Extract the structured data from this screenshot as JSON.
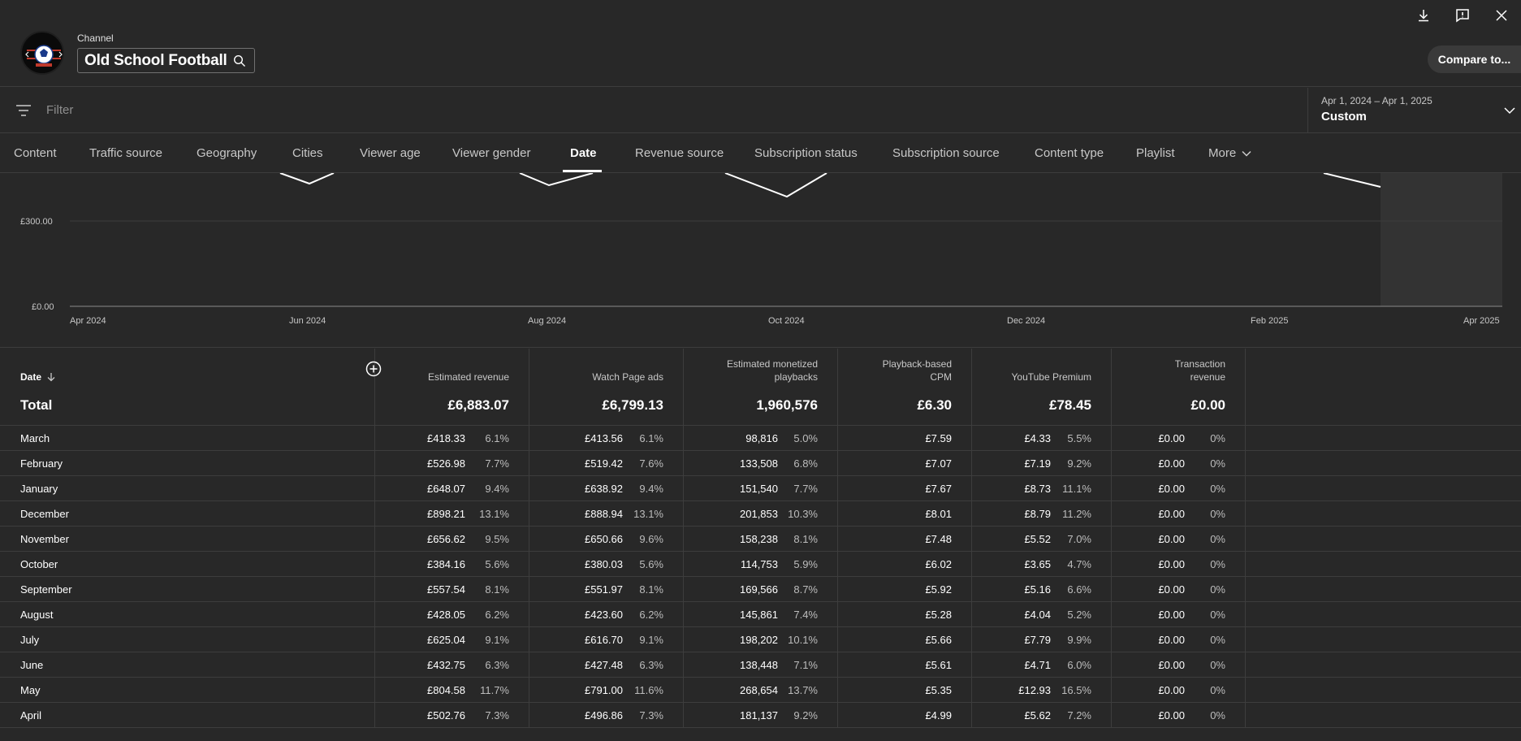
{
  "channel": {
    "label": "Channel",
    "name": "Old School Football"
  },
  "header": {
    "compare_label": "Compare to..."
  },
  "filter": {
    "placeholder": "Filter"
  },
  "date_range": {
    "range": "Apr 1, 2024 – Apr 1, 2025",
    "mode": "Custom"
  },
  "tabs": [
    {
      "label": "Content"
    },
    {
      "label": "Traffic source"
    },
    {
      "label": "Geography"
    },
    {
      "label": "Cities"
    },
    {
      "label": "Viewer age"
    },
    {
      "label": "Viewer gender"
    },
    {
      "label": "Date"
    },
    {
      "label": "Revenue source"
    },
    {
      "label": "Subscription status"
    },
    {
      "label": "Subscription source"
    },
    {
      "label": "Content type"
    },
    {
      "label": "Playlist"
    },
    {
      "label": "More"
    }
  ],
  "chart_data": {
    "type": "line",
    "y_ticks": [
      "£300.00",
      "£0.00"
    ],
    "x_ticks": [
      "Apr 2024",
      "Jun 2024",
      "Aug 2024",
      "Oct 2024",
      "Dec 2024",
      "Feb 2025",
      "Apr 2025"
    ]
  },
  "table": {
    "headers": {
      "date": "Date",
      "estimated_revenue": "Estimated revenue",
      "watch_page_ads": "Watch Page ads",
      "monetized_playbacks_1": "Estimated monetized",
      "monetized_playbacks_2": "playbacks",
      "cpm_1": "Playback-based",
      "cpm_2": "CPM",
      "premium": "YouTube Premium",
      "transaction_1": "Transaction",
      "transaction_2": "revenue"
    },
    "total": {
      "label": "Total",
      "revenue": "£6,883.07",
      "watch": "£6,799.13",
      "playbacks": "1,960,576",
      "cpm": "£6.30",
      "premium": "£78.45",
      "transaction": "£0.00"
    },
    "rows": [
      {
        "date": "March",
        "revenue": "£418.33",
        "revenue_pct": "6.1%",
        "watch": "£413.56",
        "watch_pct": "6.1%",
        "playbacks": "98,816",
        "playbacks_pct": "5.0%",
        "cpm": "£7.59",
        "premium": "£4.33",
        "premium_pct": "5.5%",
        "transaction": "£0.00",
        "transaction_pct": "0%"
      },
      {
        "date": "February",
        "revenue": "£526.98",
        "revenue_pct": "7.7%",
        "watch": "£519.42",
        "watch_pct": "7.6%",
        "playbacks": "133,508",
        "playbacks_pct": "6.8%",
        "cpm": "£7.07",
        "premium": "£7.19",
        "premium_pct": "9.2%",
        "transaction": "£0.00",
        "transaction_pct": "0%"
      },
      {
        "date": "January",
        "revenue": "£648.07",
        "revenue_pct": "9.4%",
        "watch": "£638.92",
        "watch_pct": "9.4%",
        "playbacks": "151,540",
        "playbacks_pct": "7.7%",
        "cpm": "£7.67",
        "premium": "£8.73",
        "premium_pct": "11.1%",
        "transaction": "£0.00",
        "transaction_pct": "0%"
      },
      {
        "date": "December",
        "revenue": "£898.21",
        "revenue_pct": "13.1%",
        "watch": "£888.94",
        "watch_pct": "13.1%",
        "playbacks": "201,853",
        "playbacks_pct": "10.3%",
        "cpm": "£8.01",
        "premium": "£8.79",
        "premium_pct": "11.2%",
        "transaction": "£0.00",
        "transaction_pct": "0%"
      },
      {
        "date": "November",
        "revenue": "£656.62",
        "revenue_pct": "9.5%",
        "watch": "£650.66",
        "watch_pct": "9.6%",
        "playbacks": "158,238",
        "playbacks_pct": "8.1%",
        "cpm": "£7.48",
        "premium": "£5.52",
        "premium_pct": "7.0%",
        "transaction": "£0.00",
        "transaction_pct": "0%"
      },
      {
        "date": "October",
        "revenue": "£384.16",
        "revenue_pct": "5.6%",
        "watch": "£380.03",
        "watch_pct": "5.6%",
        "playbacks": "114,753",
        "playbacks_pct": "5.9%",
        "cpm": "£6.02",
        "premium": "£3.65",
        "premium_pct": "4.7%",
        "transaction": "£0.00",
        "transaction_pct": "0%"
      },
      {
        "date": "September",
        "revenue": "£557.54",
        "revenue_pct": "8.1%",
        "watch": "£551.97",
        "watch_pct": "8.1%",
        "playbacks": "169,566",
        "playbacks_pct": "8.7%",
        "cpm": "£5.92",
        "premium": "£5.16",
        "premium_pct": "6.6%",
        "transaction": "£0.00",
        "transaction_pct": "0%"
      },
      {
        "date": "August",
        "revenue": "£428.05",
        "revenue_pct": "6.2%",
        "watch": "£423.60",
        "watch_pct": "6.2%",
        "playbacks": "145,861",
        "playbacks_pct": "7.4%",
        "cpm": "£5.28",
        "premium": "£4.04",
        "premium_pct": "5.2%",
        "transaction": "£0.00",
        "transaction_pct": "0%"
      },
      {
        "date": "July",
        "revenue": "£625.04",
        "revenue_pct": "9.1%",
        "watch": "£616.70",
        "watch_pct": "9.1%",
        "playbacks": "198,202",
        "playbacks_pct": "10.1%",
        "cpm": "£5.66",
        "premium": "£7.79",
        "premium_pct": "9.9%",
        "transaction": "£0.00",
        "transaction_pct": "0%"
      },
      {
        "date": "June",
        "revenue": "£432.75",
        "revenue_pct": "6.3%",
        "watch": "£427.48",
        "watch_pct": "6.3%",
        "playbacks": "138,448",
        "playbacks_pct": "7.1%",
        "cpm": "£5.61",
        "premium": "£4.71",
        "premium_pct": "6.0%",
        "transaction": "£0.00",
        "transaction_pct": "0%"
      },
      {
        "date": "May",
        "revenue": "£804.58",
        "revenue_pct": "11.7%",
        "watch": "£791.00",
        "watch_pct": "11.6%",
        "playbacks": "268,654",
        "playbacks_pct": "13.7%",
        "cpm": "£5.35",
        "premium": "£12.93",
        "premium_pct": "16.5%",
        "transaction": "£0.00",
        "transaction_pct": "0%"
      },
      {
        "date": "April",
        "revenue": "£502.76",
        "revenue_pct": "7.3%",
        "watch": "£496.86",
        "watch_pct": "7.3%",
        "playbacks": "181,137",
        "playbacks_pct": "9.2%",
        "cpm": "£4.99",
        "premium": "£5.62",
        "premium_pct": "7.2%",
        "transaction": "£0.00",
        "transaction_pct": "0%"
      }
    ]
  },
  "icons": {
    "download": "download-icon",
    "feedback": "feedback-icon",
    "close": "close-icon",
    "search": "search-icon",
    "filter": "filter-icon",
    "chevron": "chevron-down-icon",
    "add": "add-metric-icon",
    "sort": "sort-arrow-icon"
  }
}
